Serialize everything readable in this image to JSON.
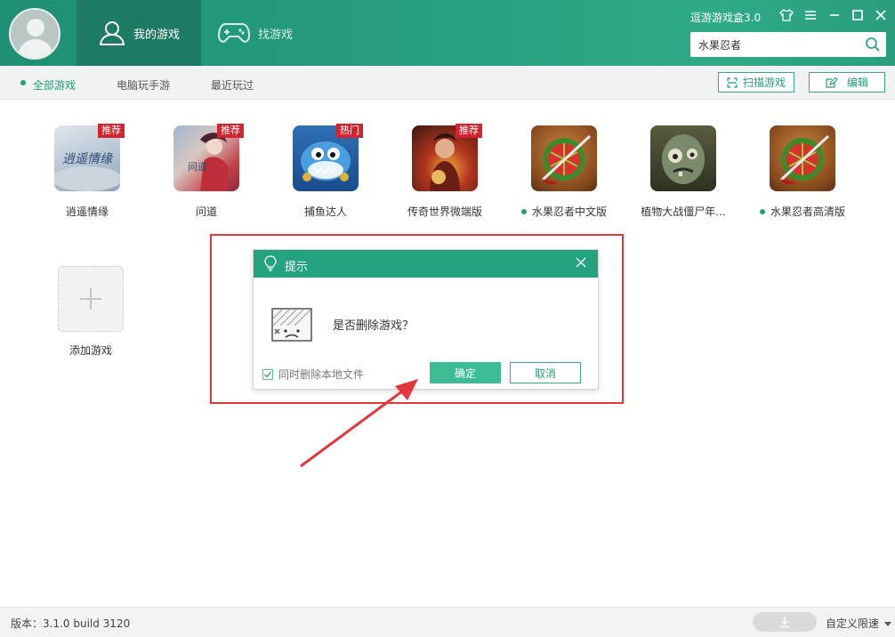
{
  "header": {
    "tabs": [
      {
        "label": "我的游戏"
      },
      {
        "label": "找游戏"
      }
    ],
    "app_title": "逗游游戏盒3.0",
    "search_value": "水果忍者"
  },
  "subnav": {
    "tabs": [
      {
        "label": "全部游戏"
      },
      {
        "label": "电脑玩手游"
      },
      {
        "label": "最近玩过"
      }
    ],
    "scan_label": "扫描游戏",
    "edit_label": "编辑"
  },
  "games": [
    {
      "name": "逍遥情缘",
      "badge": "推荐"
    },
    {
      "name": "问道",
      "badge": "推荐"
    },
    {
      "name": "捕鱼达人",
      "badge": "热门"
    },
    {
      "name": "传奇世界微端版",
      "badge": "推荐"
    },
    {
      "name": "水果忍者中文版",
      "badge": ""
    },
    {
      "name": "植物大战僵尸年...",
      "badge": ""
    },
    {
      "name": "水果忍者高清版",
      "badge": ""
    }
  ],
  "add_game_label": "添加游戏",
  "dialog": {
    "title": "提示",
    "message": "是否删除游戏？",
    "checkbox_label": "同时删除本地文件",
    "ok_label": "确定",
    "cancel_label": "取消"
  },
  "footer": {
    "version": "版本：3.1.0 build 3120",
    "speed_label": "自定义限速"
  },
  "colors": {
    "brand": "#23a27e",
    "accent_red": "#e0383c",
    "badge_red": "#d3232f"
  }
}
